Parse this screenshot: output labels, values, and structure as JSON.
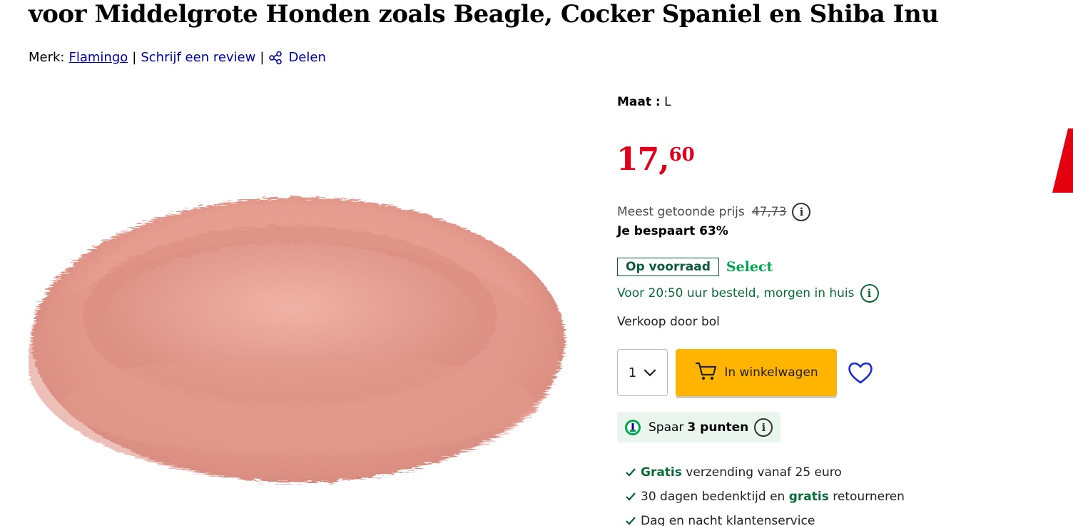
{
  "product": {
    "title": "voor Middelgrote Honden zoals Beagle, Cocker Spaniel en Shiba Inu",
    "brand_label": "Merk:",
    "brand": "Flamingo",
    "review_link": "Schrijf een review",
    "share_link": "Delen",
    "image_alt": "pink fluffy round dog bed"
  },
  "size": {
    "label": "Maat :",
    "value": "L"
  },
  "price": {
    "integer": "17,",
    "decimals": "60",
    "previous_label": "Meest getoonde prijs",
    "previous_value": "47,73",
    "savings": "Je bespaart 63%"
  },
  "stock": {
    "badge": "Op voorraad",
    "select": "Select",
    "delivery": "Voor 20:50 uur besteld, morgen in huis",
    "seller": "Verkoop door bol"
  },
  "cart": {
    "quantity": "1",
    "button_label": "In winkelwagen"
  },
  "points": {
    "prefix": "Spaar",
    "amount": "3 punten"
  },
  "usps": [
    {
      "bold": "Gratis",
      "rest": "verzending vanaf 25 euro"
    },
    {
      "pre": "30 dagen bedenktijd en",
      "bold": "gratis",
      "rest": "retourneren"
    },
    {
      "text": "Dag en nacht klantenservice"
    }
  ],
  "colors": {
    "price": "#e0001b",
    "link": "#0000a4",
    "stock_green": "#0a5b3a",
    "select_green": "#00a650",
    "cart_button": "#ffb400",
    "points_bg": "#eaf5ee",
    "product_pink": "#e8a296"
  }
}
